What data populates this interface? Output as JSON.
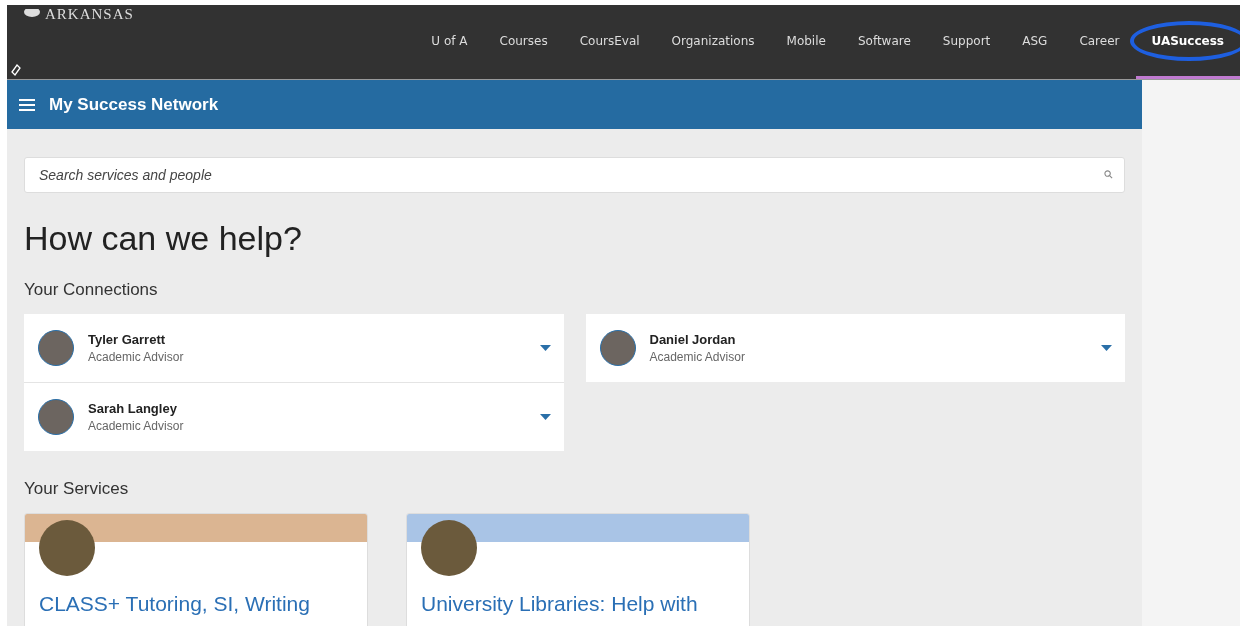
{
  "brand": {
    "wordmark": "ARKANSAS"
  },
  "nav": [
    {
      "label": "U of A",
      "selected": false
    },
    {
      "label": "Courses",
      "selected": false
    },
    {
      "label": "CoursEval",
      "selected": false
    },
    {
      "label": "Organizations",
      "selected": false
    },
    {
      "label": "Mobile",
      "selected": false
    },
    {
      "label": "Software",
      "selected": false
    },
    {
      "label": "Support",
      "selected": false
    },
    {
      "label": "ASG",
      "selected": false
    },
    {
      "label": "Career",
      "selected": false
    },
    {
      "label": "UASuccess",
      "selected": true
    }
  ],
  "header": {
    "title": "My Success Network"
  },
  "search": {
    "placeholder": "Search services and people"
  },
  "heading": "How can we help?",
  "connections": {
    "title": "Your Connections",
    "people": [
      {
        "name": "Tyler Garrett",
        "role": "Academic Advisor"
      },
      {
        "name": "Sarah Langley",
        "role": "Academic Advisor"
      },
      {
        "name": "Daniel Jordan",
        "role": "Academic Advisor"
      }
    ]
  },
  "services": {
    "title": "Your Services",
    "cards": [
      {
        "title": "CLASS+ Tutoring, SI, Writing",
        "color": "#dbb592"
      },
      {
        "title": "University Libraries: Help with",
        "color": "#a9c4e6"
      }
    ]
  }
}
